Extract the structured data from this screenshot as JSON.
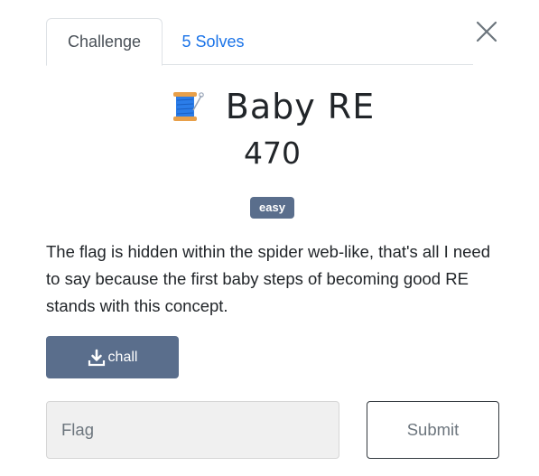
{
  "tabs": [
    {
      "label": "Challenge",
      "active": true
    },
    {
      "label": "5 Solves",
      "active": false
    }
  ],
  "challenge": {
    "icon": "thread-spool-icon",
    "name": "Baby RE",
    "points": "470",
    "difficulty": "easy",
    "description": "The flag is hidden within the spider web-like, that's all I need to say because the first baby steps of becoming good RE stands with this concept."
  },
  "download": {
    "label": "chall",
    "icon": "download-icon"
  },
  "flag_input": {
    "placeholder": "Flag",
    "value": ""
  },
  "submit_label": "Submit",
  "colors": {
    "link": "#1a73e8",
    "badge": "#5a6e8c",
    "button": "#5a6e8c",
    "input_bg": "#f0f0f0"
  }
}
